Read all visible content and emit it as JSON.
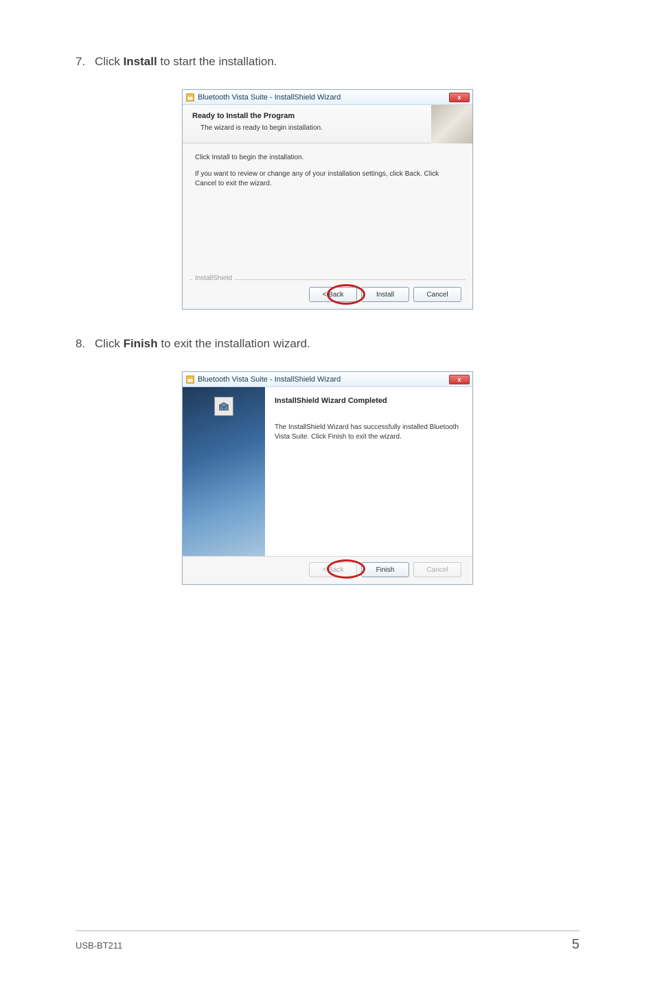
{
  "steps": {
    "s7": {
      "num": "7.",
      "pre": "Click ",
      "bold": "Install",
      "post": " to start the installation."
    },
    "s8": {
      "num": "8.",
      "pre": "Click ",
      "bold": "Finish",
      "post": " to exit the installation wizard."
    }
  },
  "dialog1": {
    "title": "Bluetooth Vista Suite - InstallShield Wizard",
    "header_title": "Ready to Install the Program",
    "header_sub": "The wizard is ready to begin installation.",
    "body_line1": "Click Install to begin the installation.",
    "body_line2": "If you want to review or change any of your installation settings, click Back. Click Cancel to exit the wizard.",
    "brand": "InstallShield",
    "buttons": {
      "back": "< Back",
      "install": "Install",
      "cancel": "Cancel"
    }
  },
  "dialog2": {
    "title": "Bluetooth Vista Suite - InstallShield Wizard",
    "completed_title": "InstallShield Wizard Completed",
    "completed_body": "The InstallShield Wizard has successfully installed Bluetooth Vista Suite. Click Finish to exit the wizard.",
    "buttons": {
      "back": "< Back",
      "finish": "Finish",
      "cancel": "Cancel"
    }
  },
  "footer": {
    "left": "USB-BT211",
    "right": "5"
  }
}
